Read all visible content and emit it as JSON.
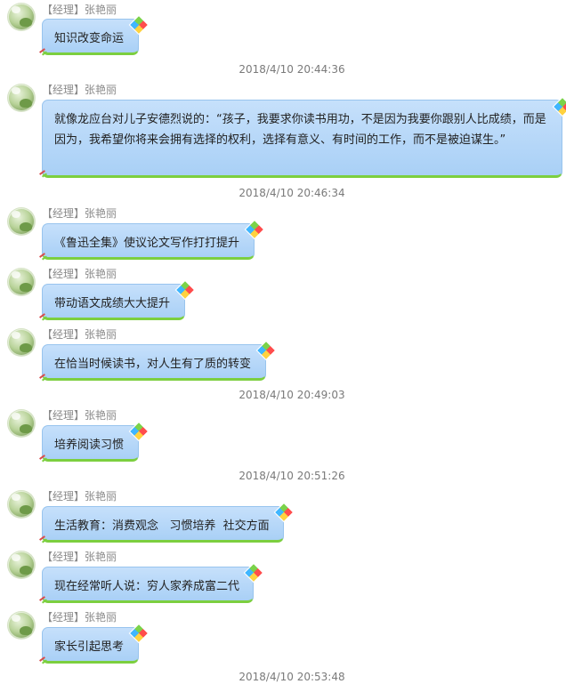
{
  "messages": [
    {
      "sender": "【经理】张艳丽",
      "text": "知识改变命运"
    },
    {
      "sender": "【经理】张艳丽",
      "text": "就像龙应台对儿子安德烈说的：“孩子，我要求你读书用功，不是因为我要你跟别人比成绩，而是因为，我希望你将来会拥有选择的权利，选择有意义、有时间的工作，而不是被迫谋生。”"
    },
    {
      "sender": "【经理】张艳丽",
      "text": "《鲁迅全集》使议论文写作打打提升"
    },
    {
      "sender": "【经理】张艳丽",
      "text": "带动语文成绩大大提升"
    },
    {
      "sender": "【经理】张艳丽",
      "text": "在恰当时候读书，对人生有了质的转变"
    },
    {
      "sender": "【经理】张艳丽",
      "text": "培养阅读习惯"
    },
    {
      "sender": "【经理】张艳丽",
      "text": "生活教育：消费观念   习惯培养  社交方面"
    },
    {
      "sender": "【经理】张艳丽",
      "text": "现在经常听人说：穷人家养成富二代"
    },
    {
      "sender": "【经理】张艳丽",
      "text": "家长引起思考"
    }
  ],
  "timestamps": [
    "2018/4/10 20:44:36",
    "2018/4/10 20:46:34",
    "2018/4/10 20:49:03",
    "2018/4/10 20:51:26",
    "2018/4/10 20:53:48"
  ],
  "colors": {
    "bubble_top": "#c6e0fb",
    "bubble_bottom": "#a9d0f6",
    "bubble_border": "#98c4ee",
    "bubble_accent": "#7ccf3f",
    "sender_text": "#8a8a8a",
    "timestamp_text": "#7a7a7a"
  }
}
